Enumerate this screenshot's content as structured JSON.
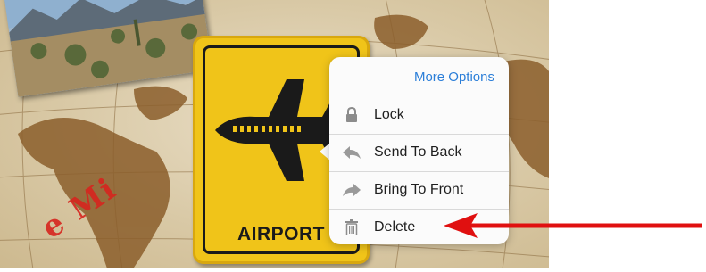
{
  "canvas": {
    "sign": {
      "label": "AIRPORT",
      "icon": "airplane-icon",
      "color": "#f0c419"
    },
    "watermark": {
      "text": "e Mi"
    },
    "photo": {
      "subject": "desert-landscape-photo"
    }
  },
  "popover": {
    "more_options": "More Options",
    "items": [
      {
        "label": "Lock",
        "icon": "lock-icon"
      },
      {
        "label": "Send To Back",
        "icon": "send-back-arrow-icon"
      },
      {
        "label": "Bring To Front",
        "icon": "bring-front-arrow-icon"
      },
      {
        "label": "Delete",
        "icon": "trash-icon"
      }
    ],
    "accent": "#2b7ed8"
  },
  "annotation": {
    "arrow_color": "#e01010",
    "points_to": "Delete"
  }
}
